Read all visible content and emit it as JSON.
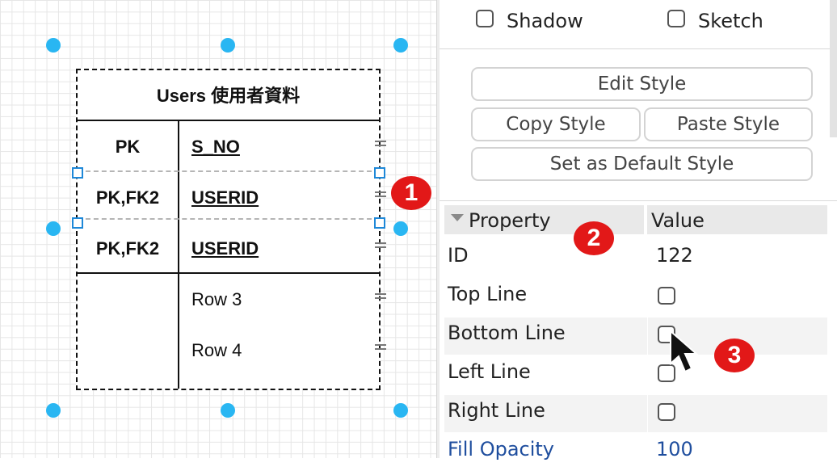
{
  "canvas": {
    "table": {
      "title": "Users 使用者資料",
      "rows": [
        {
          "key": "PK",
          "field": "S_NO",
          "primary": true
        },
        {
          "key": "PK,FK2",
          "field": "USERID",
          "primary": true
        },
        {
          "key": "PK,FK2",
          "field": "USERID",
          "primary": true
        },
        {
          "key": "",
          "field": "Row 3",
          "primary": false
        },
        {
          "key": "",
          "field": "Row 4",
          "primary": false
        }
      ]
    },
    "callouts": [
      "1",
      "2",
      "3"
    ],
    "colors": {
      "selection": "#29b6f2",
      "callout": "#e21818",
      "row_handle": "#1e88d8"
    }
  },
  "panel": {
    "options": {
      "shadow_label": "Shadow",
      "sketch_label": "Sketch"
    },
    "buttons": {
      "edit_style": "Edit Style",
      "copy_style": "Copy Style",
      "paste_style": "Paste Style",
      "set_default_style": "Set as Default Style"
    },
    "properties": {
      "header_property": "Property",
      "header_value": "Value",
      "rows": [
        {
          "name": "ID",
          "value": "122",
          "type": "text"
        },
        {
          "name": "Top Line",
          "value": "",
          "type": "checkbox"
        },
        {
          "name": "Bottom Line",
          "value": "",
          "type": "checkbox"
        },
        {
          "name": "Left Line",
          "value": "",
          "type": "checkbox"
        },
        {
          "name": "Right Line",
          "value": "",
          "type": "checkbox"
        },
        {
          "name": "Fill Opacity",
          "value": "100",
          "type": "text"
        }
      ]
    }
  }
}
